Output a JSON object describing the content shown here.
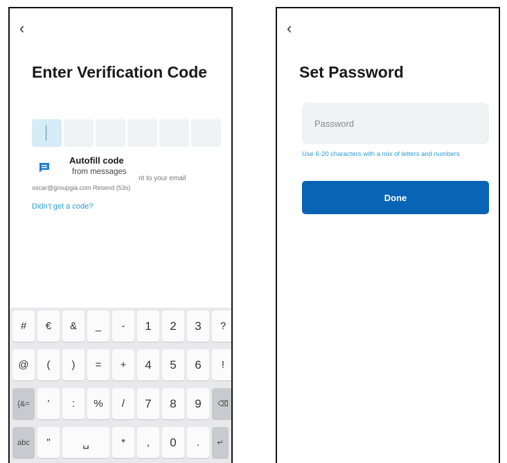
{
  "left_screen": {
    "back_glyph": "‹",
    "title": "Enter Verification Code",
    "code_box_count": 6,
    "autofill": {
      "icon": "message-icon",
      "title": "Autofill code",
      "subtitle": "from messages"
    },
    "sent_tail": "nt to your email",
    "email_line": "oscar@groupgia.com Resend (53s)",
    "no_code_link": "Didn't get a code?"
  },
  "keyboard": {
    "rows": [
      [
        "#",
        "€",
        "&",
        "_",
        "-",
        "1",
        "2",
        "3",
        "?"
      ],
      [
        "@",
        "(",
        ")",
        "=",
        "+",
        "4",
        "5",
        "6",
        "!"
      ],
      [
        "{&=",
        "'",
        ":",
        "%",
        "/",
        "7",
        "8",
        "9",
        "⌫"
      ],
      [
        "abc",
        "\"",
        "␣",
        "*",
        ",",
        "0",
        ".",
        "↵"
      ]
    ]
  },
  "right_screen": {
    "back_glyph": "‹",
    "title": "Set Password",
    "password_placeholder": "Password",
    "hint": "Use 6-20 characters with a mix of letters and numbers",
    "done_label": "Done"
  },
  "colors": {
    "accent_link": "#2a9bd6",
    "primary_button": "#0a64b5",
    "active_box": "#d6ecf7",
    "input_bg": "#f1f2f4"
  }
}
